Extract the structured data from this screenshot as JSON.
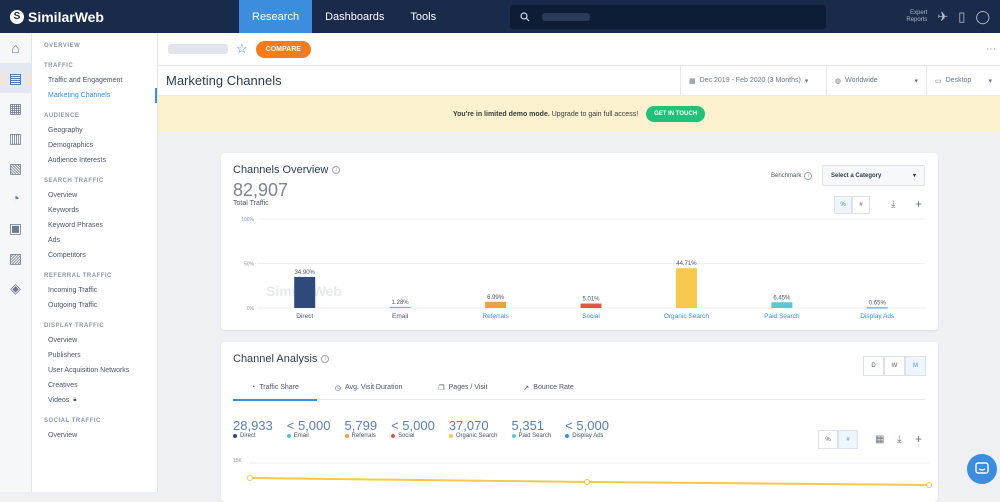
{
  "topbar": {
    "brand": "SimilarWeb",
    "tabs": [
      {
        "label": "Research",
        "active": true
      },
      {
        "label": "Dashboards",
        "active": false
      },
      {
        "label": "Tools",
        "active": false
      }
    ],
    "expert_reports_line1": "Expert",
    "expert_reports_line2": "Reports"
  },
  "sidebar": {
    "sections": [
      {
        "title": "OVERVIEW",
        "items": []
      },
      {
        "title": "TRAFFIC",
        "items": [
          {
            "label": "Traffic and Engagement",
            "active": false
          },
          {
            "label": "Marketing Channels",
            "active": true
          }
        ]
      },
      {
        "title": "AUDIENCE",
        "items": [
          {
            "label": "Geography",
            "active": false
          },
          {
            "label": "Demographics",
            "active": false
          },
          {
            "label": "Audience Interests",
            "active": false
          }
        ]
      },
      {
        "title": "SEARCH TRAFFIC",
        "items": [
          {
            "label": "Overview",
            "active": false
          },
          {
            "label": "Keywords",
            "active": false
          },
          {
            "label": "Keyword Phrases",
            "active": false
          },
          {
            "label": "Ads",
            "active": false
          },
          {
            "label": "Competitors",
            "active": false
          }
        ]
      },
      {
        "title": "REFERRAL TRAFFIC",
        "items": [
          {
            "label": "Incoming Traffic",
            "active": false
          },
          {
            "label": "Outgoing Traffic",
            "active": false
          }
        ]
      },
      {
        "title": "DISPLAY TRAFFIC",
        "items": [
          {
            "label": "Overview",
            "active": false
          },
          {
            "label": "Publishers",
            "active": false
          },
          {
            "label": "User Acquisition Networks",
            "active": false
          },
          {
            "label": "Creatives",
            "active": false
          },
          {
            "label": "Videos",
            "active": false,
            "locked": true
          }
        ]
      },
      {
        "title": "SOCIAL TRAFFIC",
        "items": [
          {
            "label": "Overview",
            "active": false
          }
        ]
      }
    ]
  },
  "header": {
    "compare_label": "COMPARE",
    "page_title": "Marketing Channels",
    "date_range": "Dec 2019 - Feb 2020 (3 Months)",
    "country": "Worldwide",
    "device": "Desktop"
  },
  "banner": {
    "bold_text": "You're in limited demo mode.",
    "text": "Upgrade to gain full access!",
    "cta": "GET IN TOUCH"
  },
  "channels_overview": {
    "title": "Channels Overview",
    "total_value": "82,907",
    "total_label": "Total Traffic",
    "benchmark_label": "Benchmark",
    "category_select": "Select a Category",
    "toggle_pct": "%",
    "toggle_num": "#",
    "watermark": "SimilarWeb",
    "chart_data": {
      "type": "bar",
      "categories": [
        "Direct",
        "Email",
        "Referrals",
        "Social",
        "Organic Search",
        "Paid Search",
        "Display Ads"
      ],
      "values": [
        34.9,
        1.28,
        6.99,
        5.01,
        44.71,
        6.45,
        0.65
      ],
      "value_labels": [
        "34.90%",
        "1.28%",
        "6.99%",
        "5.01%",
        "44.71%",
        "6.45%",
        "0.65%"
      ],
      "colors": [
        "#2d4a7a",
        "#4fc3c8",
        "#f0a03c",
        "#e0564a",
        "#f6c84c",
        "#5bc8d8",
        "#3c8dde"
      ],
      "y_ticks": [
        "100%",
        "50%",
        "0%"
      ],
      "ylim": [
        0,
        100
      ],
      "grid": true,
      "link_categories": [
        false,
        false,
        true,
        true,
        true,
        true,
        true
      ]
    }
  },
  "channel_analysis": {
    "title": "Channel Analysis",
    "granularity": [
      "D",
      "W",
      "M"
    ],
    "granularity_selected": "M",
    "tabs": [
      {
        "label": "Traffic Share",
        "active": true
      },
      {
        "label": "Avg. Visit Duration",
        "active": false
      },
      {
        "label": "Pages / Visit",
        "active": false
      },
      {
        "label": "Bounce Rate",
        "active": false
      }
    ],
    "metrics": [
      {
        "value": "28,933",
        "label": "Direct",
        "color": "#2d4a7a"
      },
      {
        "value": "< 5,000",
        "label": "Email",
        "color": "#4fc3c8"
      },
      {
        "value": "5,799",
        "label": "Referrals",
        "color": "#f0a03c"
      },
      {
        "value": "< 5,000",
        "label": "Social",
        "color": "#e0564a"
      },
      {
        "value": "37,070",
        "label": "Organic Search",
        "color": "#f6c84c"
      },
      {
        "value": "5,351",
        "label": "Paid Search",
        "color": "#5bc8d8"
      },
      {
        "value": "< 5,000",
        "label": "Display Ads",
        "color": "#3c8dde"
      }
    ],
    "toggle_pct": "%",
    "toggle_num": "#",
    "y_tick_top": "15K"
  }
}
